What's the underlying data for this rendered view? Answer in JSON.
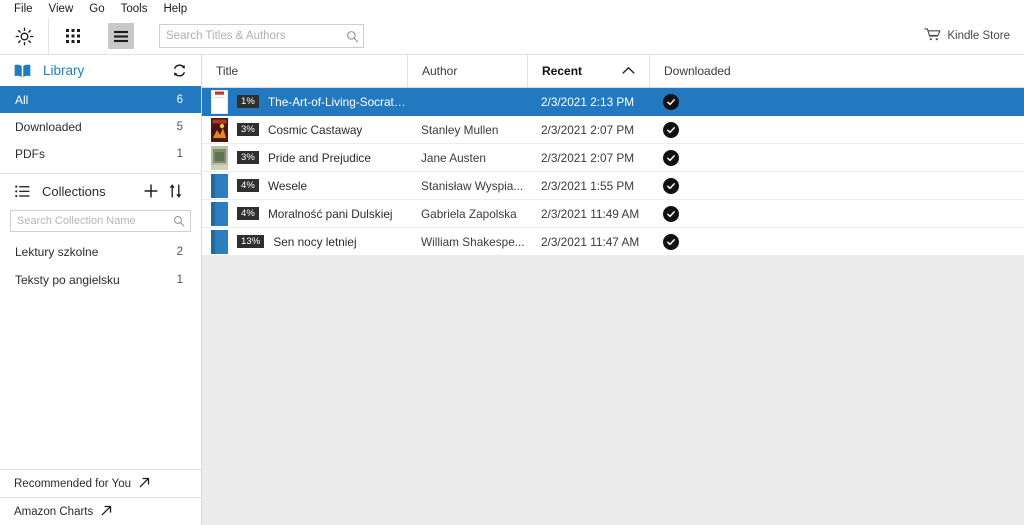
{
  "menubar": {
    "items": [
      "File",
      "View",
      "Go",
      "Tools",
      "Help"
    ]
  },
  "toolbar": {
    "brightness_icon": "sun-icon",
    "grid_view_icon": "grid-view-icon",
    "list_view_icon": "list-view-icon",
    "active_view": "list",
    "search": {
      "placeholder": "Search Titles & Authors",
      "value": "",
      "icon": "search-icon"
    },
    "store": {
      "label": "Kindle Store",
      "icon": "cart-icon"
    }
  },
  "sidebar": {
    "library": {
      "label": "Library",
      "icon": "book-icon",
      "refresh_icon": "sync-icon",
      "accent": "#1f7ec0"
    },
    "nav_items": [
      {
        "label": "All",
        "count": "6",
        "selected": true
      },
      {
        "label": "Downloaded",
        "count": "5",
        "selected": false
      },
      {
        "label": "PDFs",
        "count": "1",
        "selected": false
      }
    ],
    "collections": {
      "label": "Collections",
      "list_icon": "list-icon",
      "add_icon": "plus-icon",
      "sort_icon": "sort-arrows-icon",
      "search": {
        "placeholder": "Search Collection Name",
        "value": "",
        "icon": "search-icon"
      },
      "items": [
        {
          "label": "Lektury szkolne",
          "count": "2"
        },
        {
          "label": "Teksty po angielsku",
          "count": "1"
        }
      ]
    },
    "footer_links": [
      {
        "label": "Recommended for You",
        "icon": "external-link-icon"
      },
      {
        "label": "Amazon Charts",
        "icon": "external-link-icon"
      }
    ]
  },
  "table": {
    "columns": [
      {
        "key": "title",
        "label": "Title",
        "sorted": false
      },
      {
        "key": "author",
        "label": "Author",
        "sorted": false
      },
      {
        "key": "recent",
        "label": "Recent",
        "sorted": true,
        "sort_icon": "chevron-up-icon"
      },
      {
        "key": "downloaded",
        "label": "Downloaded",
        "sorted": false
      }
    ],
    "selection_color": "#2379bf",
    "rows": [
      {
        "progress": "1%",
        "title": "The-Art-of-Living-Socratic-Ref...",
        "author": "",
        "recent": "2/3/2021 2:13 PM",
        "downloaded": true,
        "selected": true,
        "cover": "white-red"
      },
      {
        "progress": "3%",
        "title": "Cosmic Castaway",
        "author": "Stanley Mullen",
        "recent": "2/3/2021 2:07 PM",
        "downloaded": true,
        "selected": false,
        "cover": "dark-red"
      },
      {
        "progress": "3%",
        "title": "Pride and Prejudice",
        "author": "Jane Austen",
        "recent": "2/3/2021 2:07 PM",
        "downloaded": true,
        "selected": false,
        "cover": "green-grey"
      },
      {
        "progress": "4%",
        "title": "Wesele",
        "author": "Stanisław Wyspia...",
        "recent": "2/3/2021 1:55 PM",
        "downloaded": true,
        "selected": false,
        "cover": "blue"
      },
      {
        "progress": "4%",
        "title": "Moralność pani Dulskiej",
        "author": "Gabriela Zapolska",
        "recent": "2/3/2021 11:49 AM",
        "downloaded": true,
        "selected": false,
        "cover": "blue"
      },
      {
        "progress": "13%",
        "title": "Sen nocy letniej",
        "author": "William Shakespe...",
        "recent": "2/3/2021 11:47 AM",
        "downloaded": true,
        "selected": false,
        "cover": "blue"
      }
    ]
  }
}
